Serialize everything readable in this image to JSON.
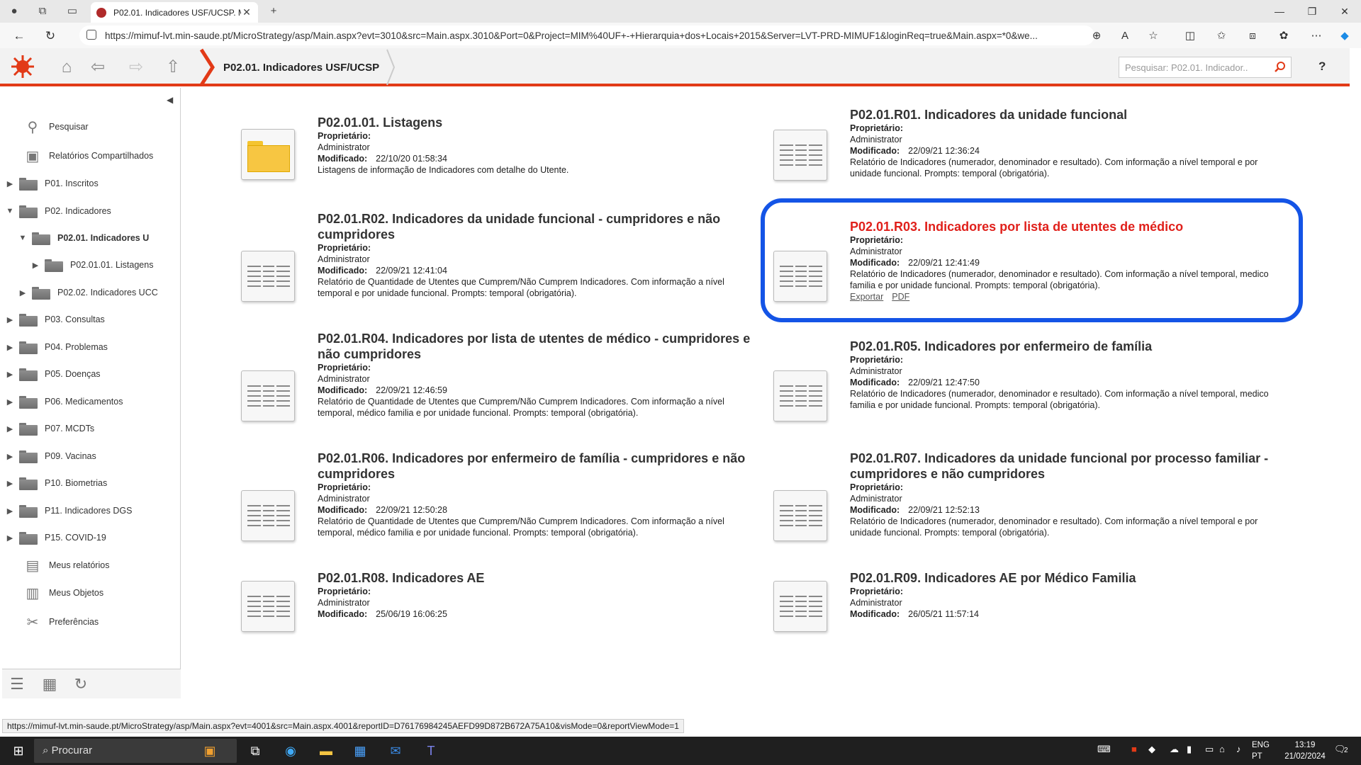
{
  "browser": {
    "tab_title": "P02.01. Indicadores USF/UCSP. M",
    "url": "https://mimuf-lvt.min-saude.pt/MicroStrategy/asp/Main.aspx?evt=3010&src=Main.aspx.3010&Port=0&Project=MIM%40UF+-+Hierarquia+dos+Locais+2015&Server=LVT-PRD-MIMUF1&loginReq=true&Main.aspx=*0&we..."
  },
  "header": {
    "breadcrumb": "P02.01. Indicadores USF/UCSP",
    "search_placeholder": "Pesquisar: P02.01. Indicador..",
    "help": "?"
  },
  "sidebar": {
    "search": "Pesquisar",
    "shared": "Relatórios Compartilhados",
    "items": [
      {
        "label": "P01. Inscritos",
        "arrow": "▶"
      },
      {
        "label": "P02. Indicadores",
        "arrow": "▼"
      },
      {
        "label": "P02.01. Indicadores U",
        "arrow": "▼"
      },
      {
        "label": "P02.01.01. Listagens",
        "arrow": "▶"
      },
      {
        "label": "P02.02. Indicadores UCC",
        "arrow": "▶"
      },
      {
        "label": "P03. Consultas",
        "arrow": "▶"
      },
      {
        "label": "P04. Problemas",
        "arrow": "▶"
      },
      {
        "label": "P05. Doenças",
        "arrow": "▶"
      },
      {
        "label": "P06. Medicamentos",
        "arrow": "▶"
      },
      {
        "label": "P07. MCDTs",
        "arrow": "▶"
      },
      {
        "label": "P09.  Vacinas",
        "arrow": "▶"
      },
      {
        "label": "P10. Biometrias",
        "arrow": "▶"
      },
      {
        "label": "P11. Indicadores DGS",
        "arrow": "▶"
      },
      {
        "label": "P15. COVID-19",
        "arrow": "▶"
      }
    ],
    "my_reports": "Meus relatórios",
    "my_objects": "Meus Objetos",
    "preferences": "Preferências"
  },
  "labels": {
    "owner": "Proprietário:",
    "modified": "Modificado:"
  },
  "cards": [
    {
      "name": "P02.01.01. Listagens",
      "owner": "Administrator",
      "modified": "22/10/20 01:58:34",
      "desc": "Listagens de informação de Indicadores com detalhe do Utente."
    },
    {
      "name": "P02.01.R01. Indicadores da unidade funcional",
      "owner": "Administrator",
      "modified": "22/09/21 12:36:24",
      "desc": "Relatório de Indicadores (numerador, denominador e resultado). Com informação a nível temporal e por unidade funcional. Prompts: temporal (obrigatória)."
    },
    {
      "name": "P02.01.R02. Indicadores da unidade funcional - cumpridores e não cumpridores",
      "owner": "Administrator",
      "modified": "22/09/21 12:41:04",
      "desc": "Relatório de Quantidade de Utentes que Cumprem/Não Cumprem Indicadores. Com informação a nível temporal e por unidade funcional. Prompts: temporal (obrigatória)."
    },
    {
      "name": "P02.01.R03. Indicadores por lista de utentes de médico",
      "owner": "Administrator",
      "modified": "22/09/21 12:41:49",
      "desc": "Relatório de Indicadores (numerador, denominador e resultado). Com informação a nível temporal, medico familia e por unidade funcional. Prompts: temporal (obrigatória).",
      "export": "Exportar",
      "pdf": "PDF"
    },
    {
      "name": "P02.01.R04. Indicadores por lista de utentes de médico - cumpridores e não cumpridores",
      "owner": "Administrator",
      "modified": "22/09/21 12:46:59",
      "desc": "Relatório de Quantidade de Utentes que Cumprem/Não Cumprem Indicadores. Com informação a nível temporal, médico familia e por unidade funcional. Prompts: temporal (obrigatória)."
    },
    {
      "name": "P02.01.R05. Indicadores por enfermeiro de família",
      "owner": "Administrator",
      "modified": "22/09/21 12:47:50",
      "desc": "Relatório de Indicadores (numerador, denominador e resultado). Com informação a nível temporal, medico familia e por unidade funcional. Prompts: temporal (obrigatória)."
    },
    {
      "name": "P02.01.R06. Indicadores por enfermeiro de família - cumpridores e não cumpridores",
      "owner": "Administrator",
      "modified": "22/09/21 12:50:28",
      "desc": "Relatório de Quantidade de Utentes que Cumprem/Não Cumprem Indicadores. Com informação a nível temporal, médico familia e por unidade funcional. Prompts: temporal (obrigatória)."
    },
    {
      "name": "P02.01.R07. Indicadores da unidade funcional por processo familiar - cumpridores e não cumpridores",
      "owner": "Administrator",
      "modified": "22/09/21 12:52:13",
      "desc": "Relatório de Indicadores (numerador, denominador e resultado). Com informação a nível temporal e por unidade funcional. Prompts: temporal (obrigatória)."
    },
    {
      "name": "P02.01.R08. Indicadores AE",
      "owner": "Administrator",
      "modified": "25/06/19 16:06:25",
      "desc": ""
    },
    {
      "name": "P02.01.R09. Indicadores AE por Médico Familia",
      "owner": "Administrator",
      "modified": "26/05/21 11:57:14",
      "desc": ""
    }
  ],
  "status_url": "https://mimuf-lvt.min-saude.pt/MicroStrategy/asp/Main.aspx?evt=4001&src=Main.aspx.4001&reportID=D76176984245AEFD99D872B672A75A10&visMode=0&reportViewMode=1",
  "taskbar": {
    "search": "Procurar",
    "lang1": "ENG",
    "lang2": "PT",
    "time": "13:19",
    "date": "21/02/2024",
    "notif": "2"
  },
  "colors": {
    "accent": "#e23a17",
    "highlight": "#1454e6",
    "active_title": "#e0201b"
  }
}
